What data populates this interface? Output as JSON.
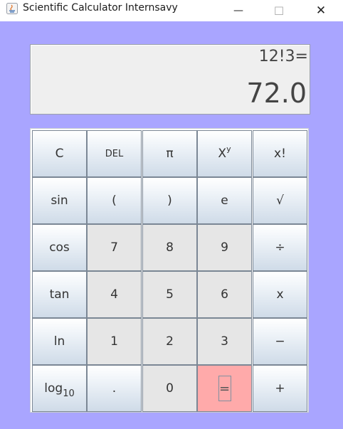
{
  "window": {
    "title": "Scientific Calculator Internsavy",
    "min_glyph": "—",
    "max_glyph": "☐",
    "close_glyph": "✕"
  },
  "display": {
    "expression": "12!3=",
    "result": "72.0"
  },
  "keys": {
    "clear": "C",
    "delete": "DEL",
    "pi": "π",
    "power_base": "X",
    "power_exp": "y",
    "factorial": "x!",
    "sin": "sin",
    "open_paren": "(",
    "close_paren": ")",
    "e": "e",
    "sqrt": "√",
    "cos": "cos",
    "seven": "7",
    "eight": "8",
    "nine": "9",
    "divide": "÷",
    "tan": "tan",
    "four": "4",
    "five": "5",
    "six": "6",
    "multiply": "x",
    "ln": "ln",
    "one": "1",
    "two": "2",
    "three": "3",
    "minus": "−",
    "log_base": "log",
    "log_sub": "10",
    "dot": ".",
    "zero": "0",
    "equals": "=",
    "plus": "+"
  },
  "colors": {
    "frame": "#a9a5ff",
    "equals_key": "#ffaaaa",
    "number_key": "#e6e6e6"
  }
}
